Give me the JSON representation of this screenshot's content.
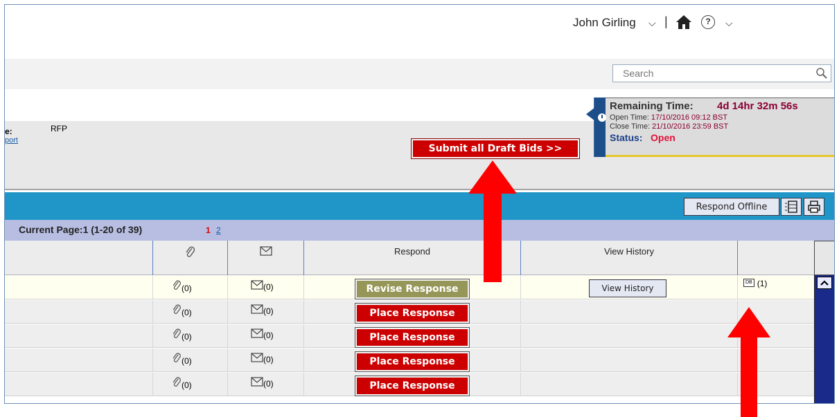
{
  "header": {
    "user_name": "John Girling",
    "user_chevron": "⌵",
    "separator": "|",
    "help_glyph": "?",
    "menu_chevron": "⌵"
  },
  "search": {
    "placeholder": "Search"
  },
  "info": {
    "type_label": "e:",
    "type_value": "RFP",
    "report_link": "port"
  },
  "actions": {
    "submit_all": "Submit all Draft Bids >>"
  },
  "timer": {
    "remaining_label": "Remaining Time:",
    "remaining_value": "4d 14hr 32m 56s",
    "open_time_label": "Open Time:",
    "open_time_value": "17/10/2016 09:12 BST",
    "close_time_label": "Close Time:",
    "close_time_value": "21/10/2016 23:59 BST",
    "status_label": "Status:",
    "status_value": "Open"
  },
  "toolbar": {
    "respond_offline": "Respond Offline"
  },
  "paging": {
    "current": "Current Page:1  (1-20 of 39)",
    "page1": "1",
    "page2": "2"
  },
  "table": {
    "headers": {
      "respond": "Respond",
      "view_history": "View History"
    },
    "rows": [
      {
        "attach": "(0)",
        "mail": "(0)",
        "respond": "Revise Response",
        "view_history": "View History",
        "db": "(1)"
      },
      {
        "attach": "(0)",
        "mail": "(0)",
        "respond": "Place Response"
      },
      {
        "attach": "(0)",
        "mail": "(0)",
        "respond": "Place Response"
      },
      {
        "attach": "(0)",
        "mail": "(0)",
        "respond": "Place Response"
      },
      {
        "attach": "(0)",
        "mail": "(0)",
        "respond": "Place Response"
      }
    ],
    "db_icon": "DB"
  },
  "colors": {
    "accent_blue": "#2096c8",
    "paging_band": "#b7bee2",
    "place_red": "#cc0000",
    "revise_olive": "#969658",
    "timer_navy": "#1c4e8a",
    "annotation_arrow": "#ff0000"
  }
}
